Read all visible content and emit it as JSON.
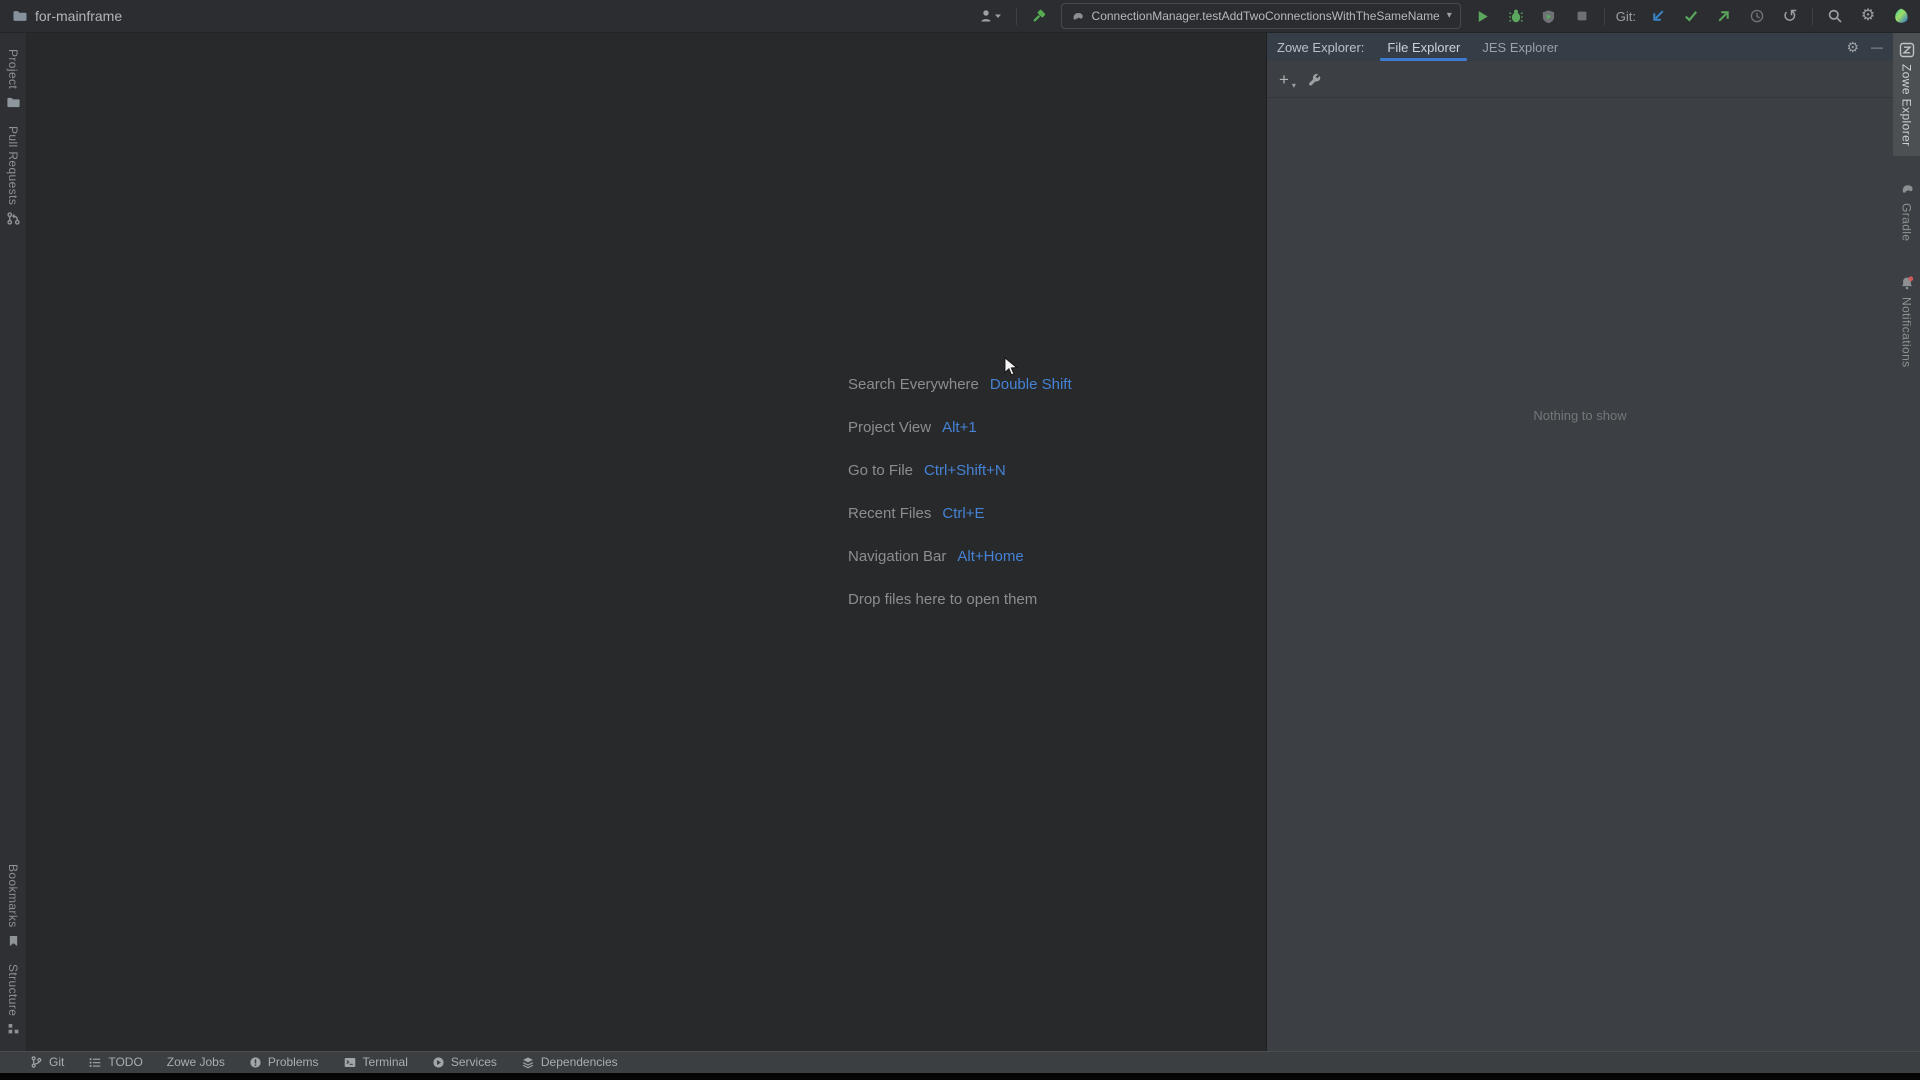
{
  "titlebar": {
    "project_name": "for-mainframe",
    "run_config": "ConnectionManager.testAddTwoConnectionsWithTheSameName",
    "git_section_label": "Git:"
  },
  "left_stripe": {
    "top": [
      {
        "label": "Project"
      },
      {
        "label": "Pull Requests"
      }
    ],
    "bottom": [
      {
        "label": "Bookmarks"
      },
      {
        "label": "Structure"
      }
    ]
  },
  "right_stripe": {
    "items": [
      {
        "label": "Zowe Explorer",
        "selected": true
      },
      {
        "label": "Gradle",
        "selected": false
      },
      {
        "label": "Notifications",
        "selected": false
      }
    ]
  },
  "editor": {
    "shortcuts": [
      {
        "label": "Search Everywhere",
        "keys": "Double Shift"
      },
      {
        "label": "Project View",
        "keys": "Alt+1"
      },
      {
        "label": "Go to File",
        "keys": "Ctrl+Shift+N"
      },
      {
        "label": "Recent Files",
        "keys": "Ctrl+E"
      },
      {
        "label": "Navigation Bar",
        "keys": "Alt+Home"
      }
    ],
    "drop_hint": "Drop files here to open them"
  },
  "tool_window": {
    "title": "Zowe Explorer:",
    "tabs": [
      {
        "label": "File Explorer"
      },
      {
        "label": "JES Explorer"
      }
    ],
    "empty_text": "Nothing to show"
  },
  "statusbar": {
    "items": [
      {
        "label": "Git"
      },
      {
        "label": "TODO"
      },
      {
        "label": "Zowe Jobs"
      },
      {
        "label": "Problems"
      },
      {
        "label": "Terminal"
      },
      {
        "label": "Services"
      },
      {
        "label": "Dependencies"
      }
    ]
  },
  "icons": {
    "gear": "⚙",
    "minimize": "—",
    "plus": "+",
    "caret": "▾",
    "undo": "↺"
  },
  "colors": {
    "accent_blue": "#3d7ad1",
    "shortcut_blue": "#4583d6",
    "run_green": "#5ca75e",
    "git_update_blue": "#3a84c8",
    "notification_red": "#d15a56",
    "panel_bg": "#3c3f44",
    "editor_bg": "#28292b"
  }
}
